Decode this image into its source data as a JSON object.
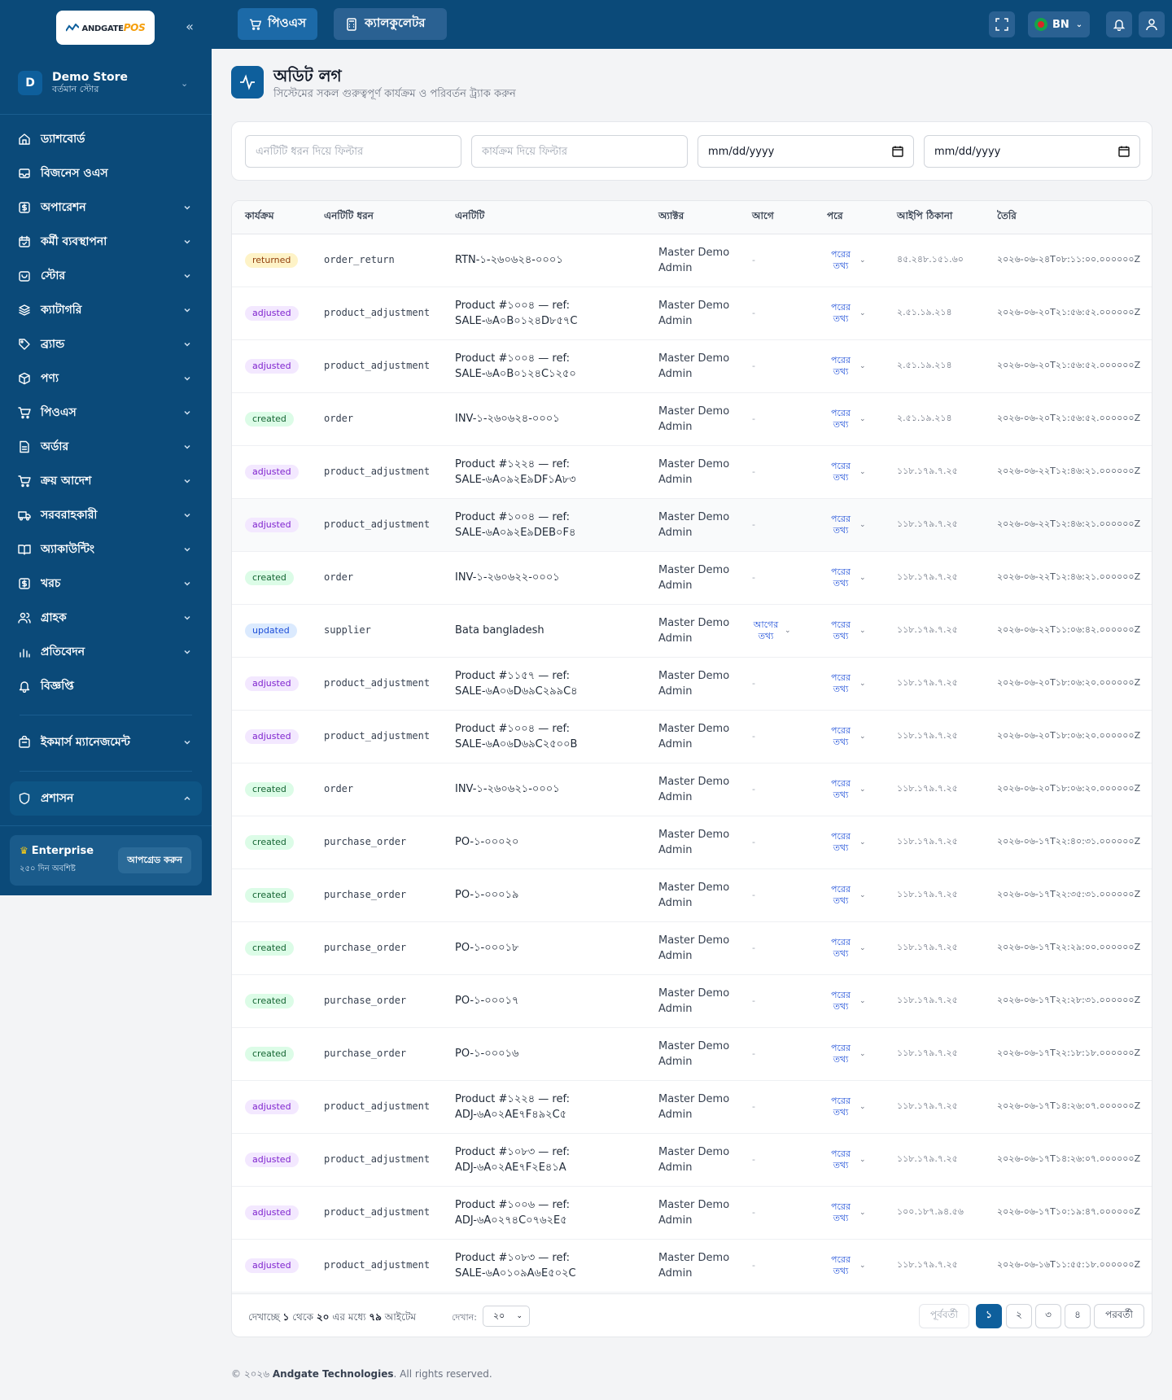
{
  "brand": {
    "logo_main": "ANDGATE",
    "logo_pos": "POS"
  },
  "store": {
    "initial": "D",
    "name": "Demo Store",
    "subtitle": "বর্তমান স্টোর"
  },
  "sidebar": {
    "items": [
      {
        "label": "ড্যাশবোর্ড",
        "icon": "home-icon",
        "chevron": false
      },
      {
        "label": "বিজনেস ওএস",
        "icon": "inbox-icon",
        "chevron": false
      },
      {
        "label": "অপারেশন",
        "icon": "dollar-icon",
        "chevron": true
      },
      {
        "label": "কর্মী ব্যবস্থাপনা",
        "icon": "calendar-icon",
        "chevron": true
      },
      {
        "label": "স্টোর",
        "icon": "store-icon",
        "chevron": true
      },
      {
        "label": "ক্যাটাগরি",
        "icon": "layers-icon",
        "chevron": true
      },
      {
        "label": "ব্র্যান্ড",
        "icon": "tag-icon",
        "chevron": true
      },
      {
        "label": "পণ্য",
        "icon": "box-icon",
        "chevron": true
      },
      {
        "label": "পিওএস",
        "icon": "cart-icon",
        "chevron": true
      },
      {
        "label": "অর্ডার",
        "icon": "file-icon",
        "chevron": true
      },
      {
        "label": "ক্রয় আদেশ",
        "icon": "cart-icon",
        "chevron": true
      },
      {
        "label": "সরবরাহকারী",
        "icon": "truck-icon",
        "chevron": true
      },
      {
        "label": "অ্যাকাউন্টিং",
        "icon": "book-icon",
        "chevron": true
      },
      {
        "label": "খরচ",
        "icon": "dollar-icon",
        "chevron": true
      },
      {
        "label": "গ্রাহক",
        "icon": "users-icon",
        "chevron": true
      },
      {
        "label": "প্রতিবেদন",
        "icon": "bar-chart-icon",
        "chevron": true
      },
      {
        "label": "বিজ্ঞপ্তি",
        "icon": "bell-icon",
        "chevron": false
      }
    ],
    "ecommerce": {
      "label": "ইকমার্স ম্যানেজমেন্ট",
      "icon": "shopping-bag-icon"
    },
    "admin": {
      "label": "প্রশাসন",
      "icon": "shield-icon"
    },
    "plan": {
      "name": "Enterprise",
      "days": "২৫০ দিন অবশিষ্ট",
      "upgrade": "আপগ্রেড করুন"
    }
  },
  "topbar": {
    "pos_label": "পিওএস",
    "calculator_label": "ক্যালকুলেটর",
    "language": "BN"
  },
  "page": {
    "title": "অডিট লগ",
    "subtitle": "সিস্টেমের সকল গুরুত্বপূর্ণ কার্যক্রম ও পরিবর্তন ট্র্যাক করুন"
  },
  "filters": {
    "entity_placeholder": "এনটিটি ধরন দিয়ে ফিল্টার",
    "action_placeholder": "কার্যক্রম দিয়ে ফিল্টার",
    "date_from": "mm/dd/yyyy",
    "date_to": "mm/dd/yyyy"
  },
  "table": {
    "headers": [
      "কার্যক্রম",
      "এনটিটি ধরন",
      "এনটিটি",
      "অ্যাক্টর",
      "আগে",
      "পরে",
      "আইপি ঠিকানা",
      "তৈরি"
    ],
    "before_info": "আগের তথ্য",
    "after_info": "পরের তথ্য",
    "rows": [
      {
        "action": "returned",
        "entity_type": "order_return",
        "entity": "RTN-১-২৬০৬২৪-০০০১",
        "actor": "Master Demo Admin",
        "before": "-",
        "ip": "৪৫.২৪৮.১৫১.৬০",
        "created": "২০২৬-০৬-২৪T০৮:১১:০০.০০০০০০Z"
      },
      {
        "action": "adjusted",
        "entity_type": "product_adjustment",
        "entity": "Product #১০০৪ — ref: SALE-৬A০B০১২৪D৮৫৭C",
        "actor": "Master Demo Admin",
        "before": "-",
        "ip": "২.৫১.১৯.২১৪",
        "created": "২০২৬-০৬-২০T২১:৫৬:৫২.০০০০০০Z"
      },
      {
        "action": "adjusted",
        "entity_type": "product_adjustment",
        "entity": "Product #১০০৪ — ref: SALE-৬A০B০১২৪C১২৫০",
        "actor": "Master Demo Admin",
        "before": "-",
        "ip": "২.৫১.১৯.২১৪",
        "created": "২০২৬-০৬-২০T২১:৫৬:৫২.০০০০০০Z"
      },
      {
        "action": "created",
        "entity_type": "order",
        "entity": "INV-১-২৬০৬২৪-০০০১",
        "actor": "Master Demo Admin",
        "before": "-",
        "ip": "২.৫১.১৯.২১৪",
        "created": "২০২৬-০৬-২০T২১:৫৬:৫২.০০০০০০Z"
      },
      {
        "action": "adjusted",
        "entity_type": "product_adjustment",
        "entity": "Product #১২২৪ — ref: SALE-৬A০৯২E৯DF১A৮৩",
        "actor": "Master Demo Admin",
        "before": "-",
        "ip": "১১৮.১৭৯.৭.২৫",
        "created": "২০২৬-০৬-২২T১২:৪৬:২১.০০০০০০Z"
      },
      {
        "action": "adjusted",
        "entity_type": "product_adjustment",
        "entity": "Product #১০০৪ — ref: SALE-৬A০৯২E৯DEB০F৪",
        "actor": "Master Demo Admin",
        "before": "-",
        "ip": "১১৮.১৭৯.৭.২৫",
        "created": "২০২৬-০৬-২২T১২:৪৬:২১.০০০০০০Z"
      },
      {
        "action": "created",
        "entity_type": "order",
        "entity": "INV-১-২৬০৬২২-০০০১",
        "actor": "Master Demo Admin",
        "before": "-",
        "ip": "১১৮.১৭৯.৭.২৫",
        "created": "২০২৬-০৬-২২T১২:৪৬:২১.০০০০০০Z"
      },
      {
        "action": "updated",
        "entity_type": "supplier",
        "entity": "Bata bangladesh",
        "actor": "Master Demo Admin",
        "before": "info",
        "ip": "১১৮.১৭৯.৭.২৫",
        "created": "২০২৬-০৬-২২T১১:০৬:৪২.০০০০০০Z"
      },
      {
        "action": "adjusted",
        "entity_type": "product_adjustment",
        "entity": "Product #১১৫৭ — ref: SALE-৬A০৬D৬৯C২৯৯C৪",
        "actor": "Master Demo Admin",
        "before": "-",
        "ip": "১১৮.১৭৯.৭.২৫",
        "created": "২০২৬-০৬-২০T১৮:০৬:২০.০০০০০০Z"
      },
      {
        "action": "adjusted",
        "entity_type": "product_adjustment",
        "entity": "Product #১০০৪ — ref: SALE-৬A০৬D৬৯C২৫০০B",
        "actor": "Master Demo Admin",
        "before": "-",
        "ip": "১১৮.১৭৯.৭.২৫",
        "created": "২০২৬-০৬-২০T১৮:০৬:২০.০০০০০০Z"
      },
      {
        "action": "created",
        "entity_type": "order",
        "entity": "INV-১-২৬০৬২১-০০০১",
        "actor": "Master Demo Admin",
        "before": "-",
        "ip": "১১৮.১৭৯.৭.২৫",
        "created": "২০২৬-০৬-২০T১৮:০৬:২০.০০০০০০Z"
      },
      {
        "action": "created",
        "entity_type": "purchase_order",
        "entity": "PO-১-০০০২০",
        "actor": "Master Demo Admin",
        "before": "-",
        "ip": "১১৮.১৭৯.৭.২৫",
        "created": "২০২৬-০৬-১৭T২২:৪০:৩১.০০০০০০Z"
      },
      {
        "action": "created",
        "entity_type": "purchase_order",
        "entity": "PO-১-০০০১৯",
        "actor": "Master Demo Admin",
        "before": "-",
        "ip": "১১৮.১৭৯.৭.২৫",
        "created": "২০২৬-০৬-১৭T২২:৩৫:৩১.০০০০০০Z"
      },
      {
        "action": "created",
        "entity_type": "purchase_order",
        "entity": "PO-১-০০০১৮",
        "actor": "Master Demo Admin",
        "before": "-",
        "ip": "১১৮.১৭৯.৭.২৫",
        "created": "২০২৬-০৬-১৭T২২:২৯:০০.০০০০০০Z"
      },
      {
        "action": "created",
        "entity_type": "purchase_order",
        "entity": "PO-১-০০০১৭",
        "actor": "Master Demo Admin",
        "before": "-",
        "ip": "১১৮.১৭৯.৭.২৫",
        "created": "২০২৬-০৬-১৭T২২:২৮:৩১.০০০০০০Z"
      },
      {
        "action": "created",
        "entity_type": "purchase_order",
        "entity": "PO-১-০০০১৬",
        "actor": "Master Demo Admin",
        "before": "-",
        "ip": "১১৮.১৭৯.৭.২৫",
        "created": "২০২৬-০৬-১৭T২২:১৮:১৮.০০০০০০Z"
      },
      {
        "action": "adjusted",
        "entity_type": "product_adjustment",
        "entity": "Product #১২২৪ — ref: ADJ-৬A০২AE৭F৪৯২C৫",
        "actor": "Master Demo Admin",
        "before": "-",
        "ip": "১১৮.১৭৯.৭.২৫",
        "created": "২০২৬-০৬-১৭T১৪:২৬:০৭.০০০০০০Z"
      },
      {
        "action": "adjusted",
        "entity_type": "product_adjustment",
        "entity": "Product #১০৮৩ — ref: ADJ-৬A০২AE৭F২E৪১A",
        "actor": "Master Demo Admin",
        "before": "-",
        "ip": "১১৮.১৭৯.৭.২৫",
        "created": "২০২৬-০৬-১৭T১৪:২৬:০৭.০০০০০০Z"
      },
      {
        "action": "adjusted",
        "entity_type": "product_adjustment",
        "entity": "Product #১০০৬ — ref: ADJ-৬A০২৭৪C০৭৬২E৫",
        "actor": "Master Demo Admin",
        "before": "-",
        "ip": "১০০.১৮৭.৯৪.৫৬",
        "created": "২০২৬-০৬-১৭T১০:১৯:৪৭.০০০০০০Z"
      },
      {
        "action": "adjusted",
        "entity_type": "product_adjustment",
        "entity": "Product #১০৮৩ — ref: SALE-৬A০১০৯A৬E৫০২C",
        "actor": "Master Demo Admin",
        "before": "-",
        "ip": "১১৮.১৭৯.৭.২৫",
        "created": "২০২৬-০৬-১৬T১১:৫৫:১৮.০০০০০০Z"
      }
    ]
  },
  "pagination": {
    "prefix": "দেখাচ্ছে",
    "from": "১",
    "mid1": "থেকে",
    "to": "২০",
    "mid2": "এর মধ্যে",
    "total": "৭৯",
    "suffix": "আইটেম",
    "show_label": "দেখান:",
    "page_size": "২০",
    "prev": "পূর্ববর্তী",
    "next": "পরবর্তী",
    "pages": [
      "১",
      "২",
      "৩",
      "৪"
    ],
    "current": "১"
  },
  "footer": {
    "copy": "© ২০২৬",
    "company": "Andgate Technologies",
    "rights": ". All rights reserved."
  },
  "colors": {
    "sidebar": "#0b4a79",
    "accent": "#0e5f9c"
  }
}
